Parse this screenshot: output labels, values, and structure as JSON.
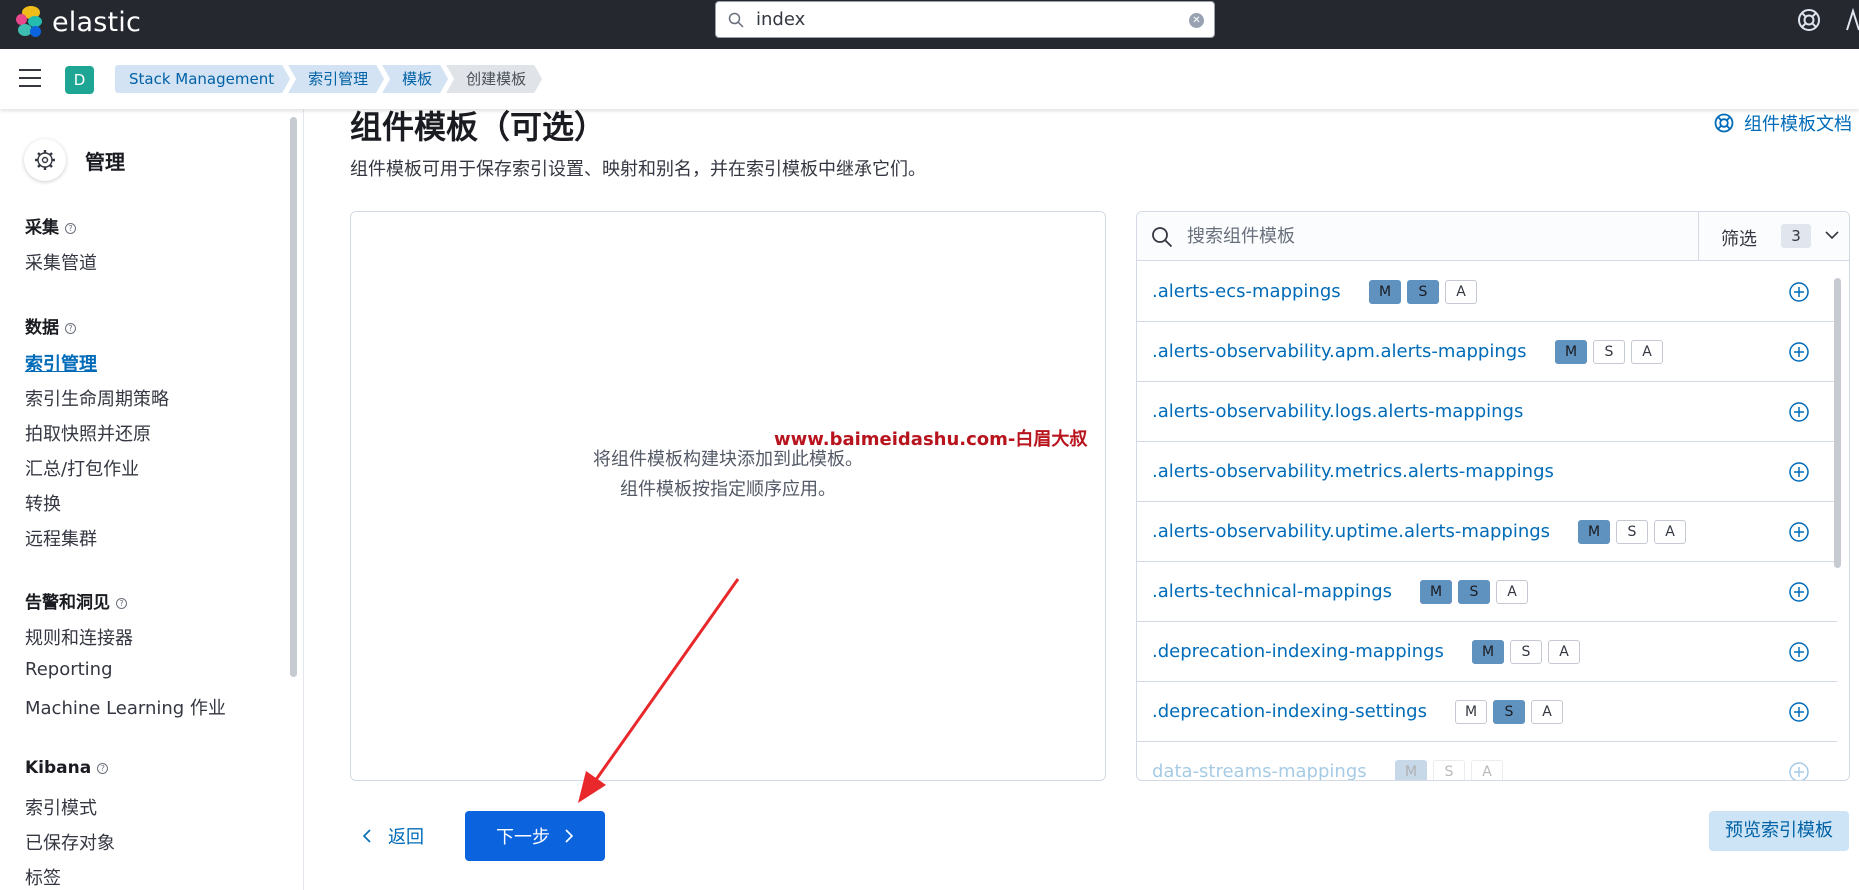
{
  "header": {
    "brand": "elastic",
    "search_value": "index"
  },
  "subheader": {
    "space_initial": "D",
    "breadcrumbs": [
      "Stack Management",
      "索引管理",
      "模板",
      "创建模板"
    ]
  },
  "sidebar": {
    "title": "管理",
    "sections": [
      {
        "label": "采集",
        "items": [
          "采集管道"
        ]
      },
      {
        "label": "数据",
        "items": [
          "索引管理",
          "索引生命周期策略",
          "拍取快照并还原",
          "汇总/打包作业",
          "转换",
          "远程集群"
        ]
      },
      {
        "label": "告警和洞见",
        "items": [
          "规则和连接器",
          "Reporting",
          "Machine Learning 作业"
        ]
      },
      {
        "label": "Kibana",
        "items": [
          "索引模式",
          "已保存对象",
          "标签"
        ]
      }
    ],
    "active_item": "索引管理"
  },
  "main": {
    "title": "组件模板（可选）",
    "description": "组件模板可用于保存索引设置、映射和别名，并在索引模板中继承它们。",
    "doc_link": "组件模板文档",
    "drop_text_line1": "将组件模板构建块添加到此模板。",
    "drop_text_line2": "组件模板按指定顺序应用。",
    "watermark": "www.baimeidashu.com-白眉大叔"
  },
  "list": {
    "search_placeholder": "搜索组件模板",
    "filter_label": "筛选",
    "filter_count": "3",
    "badge_labels": [
      "M",
      "S",
      "A"
    ],
    "rows": [
      {
        "name": ".alerts-ecs-mappings",
        "badges": [
          true,
          true,
          false
        ],
        "show_badges": true
      },
      {
        "name": ".alerts-observability.apm.alerts-mappings",
        "badges": [
          true,
          false,
          false
        ],
        "show_badges": true
      },
      {
        "name": ".alerts-observability.logs.alerts-mappings",
        "badges": [],
        "show_badges": false
      },
      {
        "name": ".alerts-observability.metrics.alerts-mappings",
        "badges": [],
        "show_badges": false
      },
      {
        "name": ".alerts-observability.uptime.alerts-mappings",
        "badges": [
          true,
          false,
          false
        ],
        "show_badges": true
      },
      {
        "name": ".alerts-technical-mappings",
        "badges": [
          true,
          true,
          false
        ],
        "show_badges": true
      },
      {
        "name": ".deprecation-indexing-mappings",
        "badges": [
          true,
          false,
          false
        ],
        "show_badges": true
      },
      {
        "name": ".deprecation-indexing-settings",
        "badges": [
          false,
          true,
          false
        ],
        "show_badges": true
      },
      {
        "name": "data-streams-mappings",
        "badges": [
          true,
          false,
          false
        ],
        "show_badges": true
      }
    ]
  },
  "footer": {
    "back_label": "返回",
    "next_label": "下一步",
    "preview_label": "预览索引模板"
  },
  "colors": {
    "header_bg": "#25282f",
    "link": "#006bb8",
    "primary_button": "#0b64dd",
    "badge_active": "#6092c0",
    "arrow": "#e8282b",
    "watermark": "#b8141e"
  }
}
